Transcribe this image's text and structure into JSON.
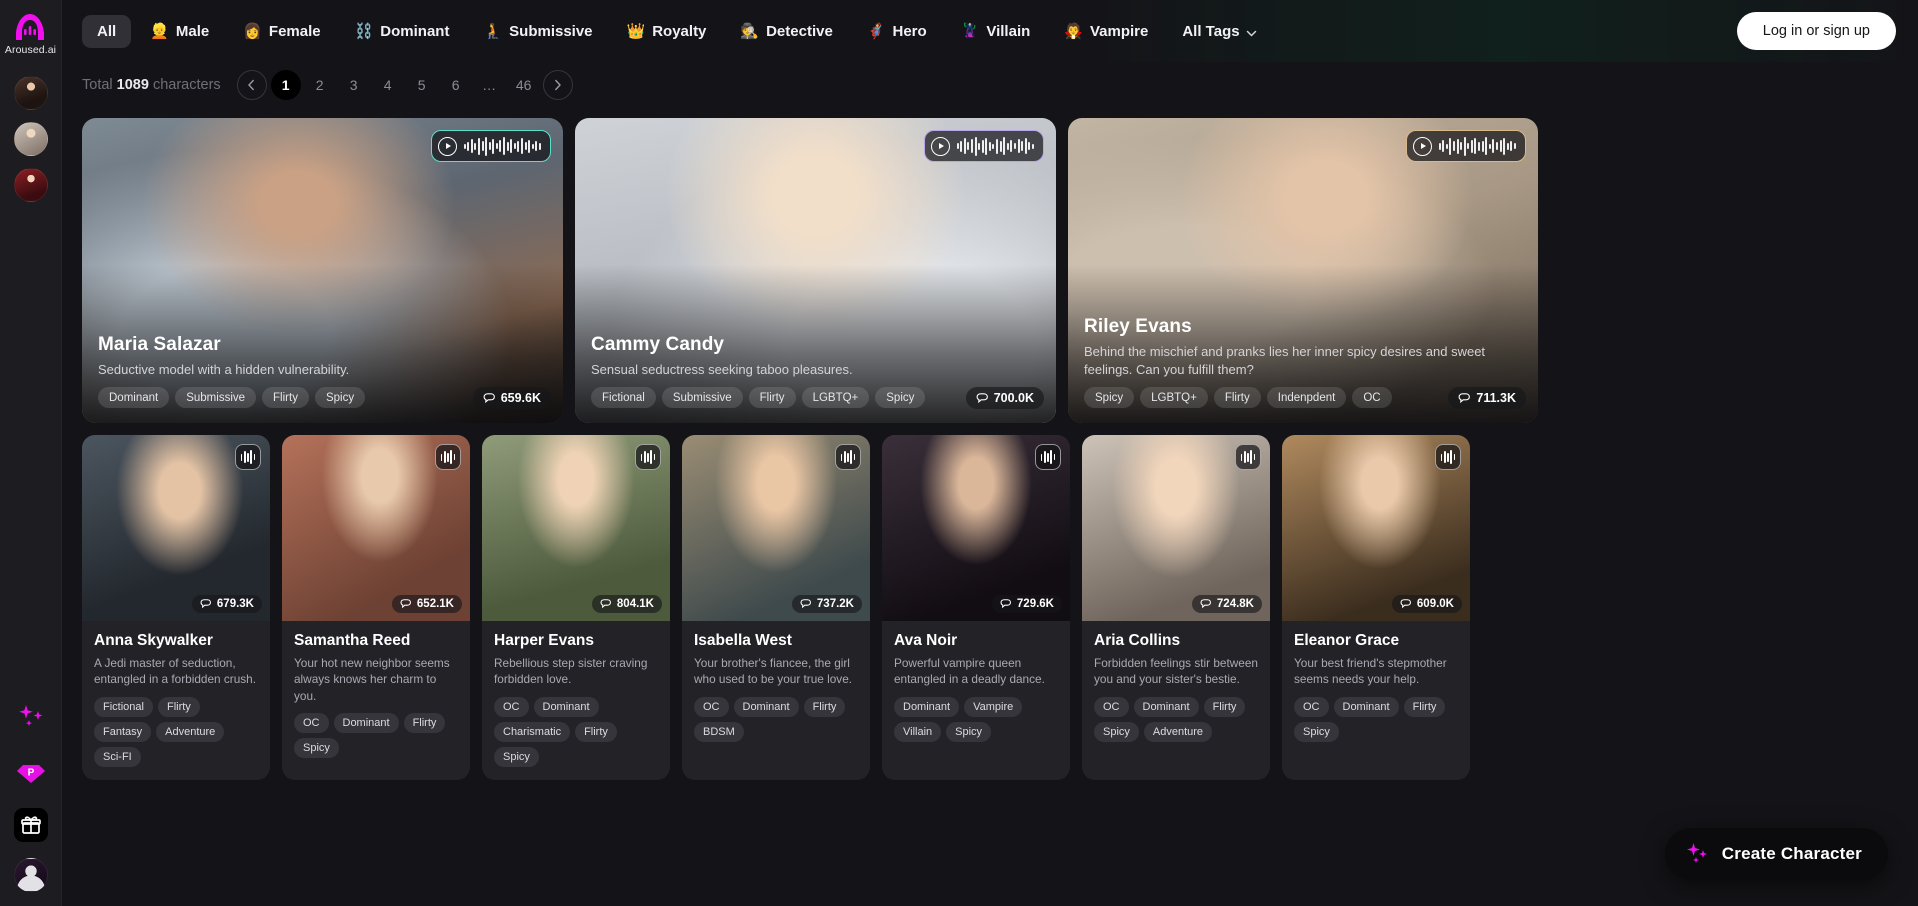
{
  "brand": {
    "name": "Aroused.ai",
    "logo_icon": "aroused-logo-icon"
  },
  "rail": {
    "avatars": [
      {
        "name": "rail-avatar-1"
      },
      {
        "name": "rail-avatar-2"
      },
      {
        "name": "rail-avatar-3"
      }
    ],
    "sparkle_icon": "sparkles-icon",
    "premium_icon": "premium-diamond-icon",
    "gift_icon": "gift-icon",
    "user_icon": "user-avatar-icon"
  },
  "nav": {
    "tabs": [
      {
        "label": "All",
        "emoji": "",
        "active": true
      },
      {
        "label": "Male",
        "emoji": "👱",
        "active": false
      },
      {
        "label": "Female",
        "emoji": "👩",
        "active": false
      },
      {
        "label": "Dominant",
        "emoji": "⛓️",
        "active": false
      },
      {
        "label": "Submissive",
        "emoji": "🧎",
        "active": false
      },
      {
        "label": "Royalty",
        "emoji": "👑",
        "active": false
      },
      {
        "label": "Detective",
        "emoji": "🕵️",
        "active": false
      },
      {
        "label": "Hero",
        "emoji": "🦸",
        "active": false
      },
      {
        "label": "Villain",
        "emoji": "🦹",
        "active": false
      },
      {
        "label": "Vampire",
        "emoji": "🧛",
        "active": false
      }
    ],
    "all_tags_label": "All Tags",
    "login_label": "Log in or sign up"
  },
  "subbar": {
    "total_prefix": "Total",
    "total_count": "1089",
    "total_suffix": "characters",
    "pages": [
      "1",
      "2",
      "3",
      "4",
      "5",
      "6",
      "…",
      "46"
    ],
    "active_page": "1",
    "prev_icon": "chevron-left-icon",
    "next_icon": "chevron-right-icon"
  },
  "featured": [
    {
      "name": "Maria Salazar",
      "description": "Seductive model with a hidden vulnerability.",
      "tags": [
        "Dominant",
        "Submissive",
        "Flirty",
        "Spicy"
      ],
      "chats": "659.6K",
      "audio_accent": "#5ae0c8"
    },
    {
      "name": "Cammy Candy",
      "description": "Sensual seductress seeking taboo pleasures.",
      "tags": [
        "Fictional",
        "Submissive",
        "Flirty",
        "LGBTQ+",
        "Spicy"
      ],
      "chats": "700.0K",
      "audio_accent": "#b9a6e8"
    },
    {
      "name": "Riley Evans",
      "description": "Behind the mischief and pranks lies her inner spicy desires and sweet feelings. Can you fulfill them?",
      "tags": [
        "Spicy",
        "LGBTQ+",
        "Flirty",
        "Indenpdent",
        "OC"
      ],
      "chats": "711.3K",
      "audio_accent": "#d9b98a"
    }
  ],
  "cards": [
    {
      "name": "Anna Skywalker",
      "description": "A Jedi master of seduction, entangled in a forbidden crush.",
      "tags": [
        "Fictional",
        "Flirty",
        "Fantasy",
        "Adventure",
        "Sci-FI"
      ],
      "chats": "679.3K"
    },
    {
      "name": "Samantha Reed",
      "description": "Your hot new neighbor seems always knows her charm to you.",
      "tags": [
        "OC",
        "Dominant",
        "Flirty",
        "Spicy"
      ],
      "chats": "652.1K"
    },
    {
      "name": "Harper Evans",
      "description": "Rebellious step sister craving forbidden love.",
      "tags": [
        "OC",
        "Dominant",
        "Charismatic",
        "Flirty",
        "Spicy"
      ],
      "chats": "804.1K"
    },
    {
      "name": "Isabella West",
      "description": "Your brother's fiancee, the girl who used to be your true love.",
      "tags": [
        "OC",
        "Dominant",
        "Flirty",
        "BDSM"
      ],
      "chats": "737.2K"
    },
    {
      "name": "Ava Noir",
      "description": "Powerful vampire queen entangled in a deadly dance.",
      "tags": [
        "Dominant",
        "Vampire",
        "Villain",
        "Spicy"
      ],
      "chats": "729.6K"
    },
    {
      "name": "Aria Collins",
      "description": "Forbidden feelings stir between you and your sister's bestie.",
      "tags": [
        "OC",
        "Dominant",
        "Flirty",
        "Spicy",
        "Adventure"
      ],
      "chats": "724.8K"
    },
    {
      "name": "Eleanor Grace",
      "description": "Your best friend's stepmother seems needs your help.",
      "tags": [
        "OC",
        "Dominant",
        "Flirty",
        "Spicy"
      ],
      "chats": "609.0K"
    }
  ],
  "fab": {
    "label": "Create Character",
    "icon": "sparkles-icon"
  },
  "colors": {
    "accent_pink": "#f10ff0",
    "fab_bg": "#0b0b0d",
    "page_bg": "#141418"
  }
}
